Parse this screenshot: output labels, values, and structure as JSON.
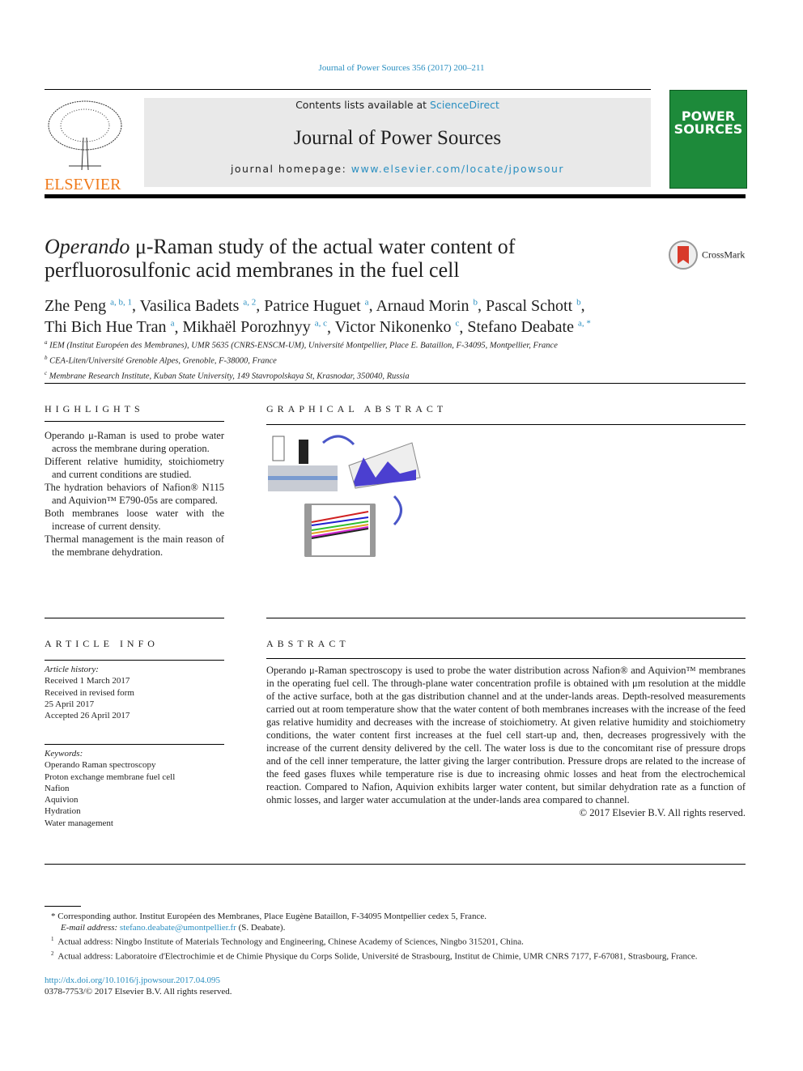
{
  "header": {
    "citation": "Journal of Power Sources 356 (2017) 200–211",
    "contents_prefix": "Contents lists available at ",
    "contents_link": "ScienceDirect",
    "journal_name": "Journal of Power Sources",
    "homepage_prefix": "journal homepage: ",
    "homepage_link": "www.elsevier.com/locate/jpowsour",
    "publisher_logo": "ELSEVIER",
    "cover_text": "POWER SOURCES",
    "crossmark": "CrossMark"
  },
  "article": {
    "title_italic": "Operando",
    "title_rest": " μ-Raman study of the actual water content of perfluorosulfonic acid membranes in the fuel cell",
    "authors": [
      {
        "name": "Zhe Peng",
        "sup": "a, b, 1"
      },
      {
        "name": "Vasilica Badets",
        "sup": "a, 2"
      },
      {
        "name": "Patrice Huguet",
        "sup": "a"
      },
      {
        "name": "Arnaud Morin",
        "sup": "b"
      },
      {
        "name": "Pascal Schott",
        "sup": "b"
      },
      {
        "name": "Thi Bich Hue Tran",
        "sup": "a"
      },
      {
        "name": "Mikhaël Porozhnyy",
        "sup": "a, c"
      },
      {
        "name": "Victor Nikonenko",
        "sup": "c"
      },
      {
        "name": "Stefano Deabate",
        "sup": "a, *"
      }
    ],
    "affiliations": [
      {
        "mark": "a",
        "text": "IEM (Institut Européen des Membranes), UMR 5635 (CNRS-ENSCM-UM), Université Montpellier, Place E. Bataillon, F-34095, Montpellier, France"
      },
      {
        "mark": "b",
        "text": "CEA-Liten/Université Grenoble Alpes, Grenoble, F-38000, France"
      },
      {
        "mark": "c",
        "text": "Membrane Research Institute, Kuban State University, 149 Stavropolskaya St, Krasnodar, 350040, Russia"
      }
    ]
  },
  "highlights": {
    "heading": "HIGHLIGHTS",
    "items": [
      "Operando μ-Raman is used to probe water across the membrane during operation.",
      "Different relative humidity, stoichiometry and current conditions are studied.",
      "The hydration behaviors of Nafion® N115 and Aquivion™ E790-05s are compared.",
      "Both membranes loose water with the increase of current density.",
      "Thermal management is the main reason of the membrane dehydration."
    ]
  },
  "graphical_abstract": {
    "heading": "GRAPHICAL ABSTRACT"
  },
  "article_info": {
    "heading": "ARTICLE INFO",
    "history_label": "Article history:",
    "history": [
      "Received 1 March 2017",
      "Received in revised form",
      "25 April 2017",
      "Accepted 26 April 2017"
    ],
    "keywords_label": "Keywords:",
    "keywords": [
      "Operando Raman spectroscopy",
      "Proton exchange membrane fuel cell",
      "Nafion",
      "Aquivion",
      "Hydration",
      "Water management"
    ]
  },
  "abstract": {
    "heading": "ABSTRACT",
    "text": "Operando μ-Raman spectroscopy is used to probe the water distribution across Nafion® and Aquivion™ membranes in the operating fuel cell. The through-plane water concentration profile is obtained with μm resolution at the middle of the active surface, both at the gas distribution channel and at the under-lands areas. Depth-resolved measurements carried out at room temperature show that the water content of both membranes increases with the increase of the feed gas relative humidity and decreases with the increase of stoichiometry. At given relative humidity and stoichiometry conditions, the water content first increases at the fuel cell start-up and, then, decreases progressively with the increase of the current density delivered by the cell. The water loss is due to the concomitant rise of pressure drops and of the cell inner temperature, the latter giving the larger contribution. Pressure drops are related to the increase of the feed gases fluxes while temperature rise is due to increasing ohmic losses and heat from the electrochemical reaction. Compared to Nafion, Aquivion exhibits larger water content, but similar dehydration rate as a function of ohmic losses, and larger water accumulation at the under-lands area compared to channel.",
    "copyright": "© 2017 Elsevier B.V. All rights reserved."
  },
  "footnotes": {
    "corresponding": "Corresponding author. Institut Européen des Membranes, Place Eugène Bataillon, F-34095 Montpellier cedex 5, France.",
    "email_label": "E-mail address: ",
    "email": "stefano.deabate@umontpellier.fr",
    "email_suffix": " (S. Deabate).",
    "note1": "Actual address: Ningbo Institute of Materials Technology and Engineering, Chinese Academy of Sciences, Ningbo 315201, China.",
    "note2": "Actual address: Laboratoire d'Electrochimie et de Chimie Physique du Corps Solide, Université de Strasbourg, Institut de Chimie, UMR CNRS 7177, F-67081, Strasbourg, France.",
    "doi": "http://dx.doi.org/10.1016/j.jpowsour.2017.04.095",
    "issn": "0378-7753/© 2017 Elsevier B.V. All rights reserved."
  }
}
